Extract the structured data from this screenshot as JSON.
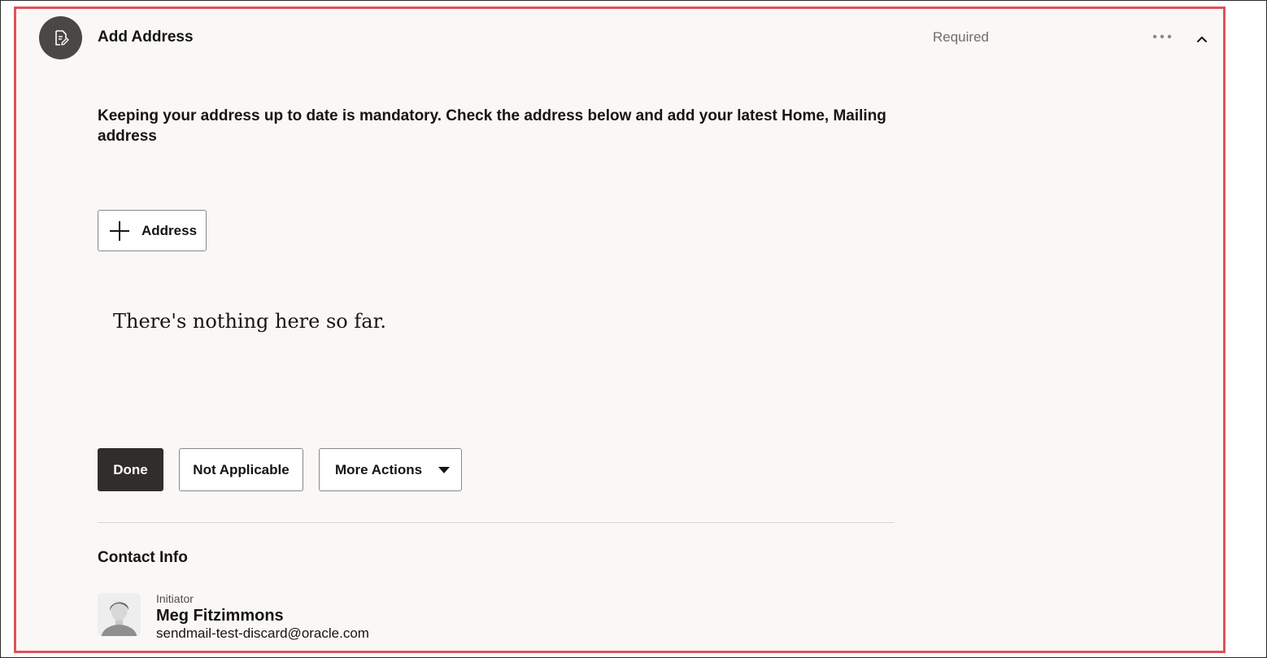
{
  "header": {
    "title": "Add Address",
    "status": "Required",
    "icon": "document-edit-icon"
  },
  "instructions": "Keeping your address up to date is mandatory. Check the address below and add your latest Home, Mailing address",
  "add_button": {
    "label": "Address",
    "icon": "plus-icon"
  },
  "empty_state": "There's nothing here so far.",
  "actions": {
    "done": "Done",
    "not_applicable": "Not Applicable",
    "more_actions": "More Actions"
  },
  "contact": {
    "section_title": "Contact Info",
    "role": "Initiator",
    "name": "Meg Fitzimmons",
    "email": "sendmail-test-discard@oracle.com"
  },
  "colors": {
    "highlight_border": "#e0525a",
    "primary_button": "#312d2a",
    "panel_background": "#f9f8f6"
  }
}
